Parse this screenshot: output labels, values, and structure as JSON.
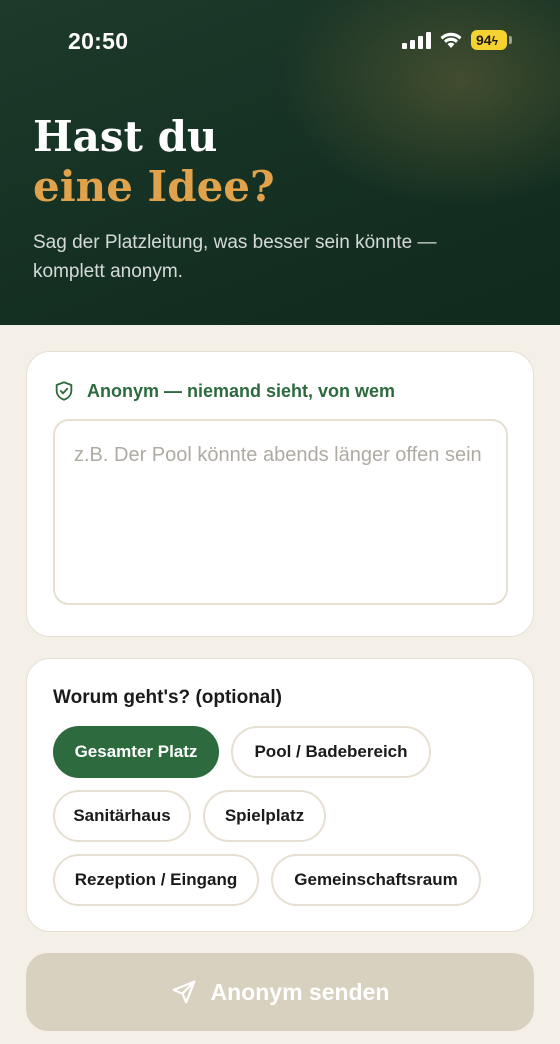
{
  "status_bar": {
    "time": "20:50",
    "battery": "94"
  },
  "hero": {
    "title_line1": "Hast du",
    "title_line2": "eine Idee?",
    "subtitle": "Sag der Platzleitung, was besser sein könnte — komplett anonym."
  },
  "anonymous": {
    "label": "Anonym — niemand sieht, von wem",
    "icon": "shield-check-icon",
    "input_placeholder": "z.B. Der Pool könnte abends länger offen sein",
    "input_value": ""
  },
  "topic": {
    "title": "Worum geht's? (optional)",
    "chips": [
      {
        "label": "Gesamter Platz",
        "active": true
      },
      {
        "label": "Pool / Badebereich",
        "active": false
      },
      {
        "label": "Sanitärhaus",
        "active": false
      },
      {
        "label": "Spielplatz",
        "active": false
      },
      {
        "label": "Rezeption / Eingang",
        "active": false
      },
      {
        "label": "Gemeinschaftsraum",
        "active": false
      }
    ]
  },
  "send": {
    "label": "Anonym senden",
    "icon": "paper-plane-icon"
  },
  "colors": {
    "accent_green": "#2d6a3e",
    "accent_gold": "#e0a24a",
    "hero_bg": "#163224",
    "page_bg": "#f4f0e8",
    "button_disabled": "#d8d1c0"
  }
}
